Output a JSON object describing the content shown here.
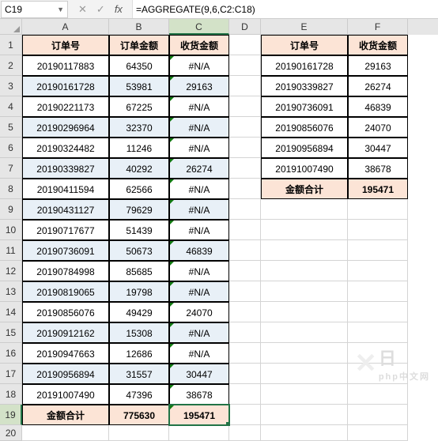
{
  "name_box": "C19",
  "formula": "=AGGREGATE(9,6,C2:C18)",
  "columns": [
    "A",
    "B",
    "C",
    "D",
    "E",
    "F"
  ],
  "left_header": {
    "a": "订单号",
    "b": "订单金额",
    "c": "收货金额"
  },
  "right_header": {
    "e": "订单号",
    "f": "收货金额"
  },
  "left_rows": [
    {
      "a": "20190117883",
      "b": "64350",
      "c": "#N/A",
      "alt": false
    },
    {
      "a": "20190161728",
      "b": "53981",
      "c": "29163",
      "alt": true
    },
    {
      "a": "20190221173",
      "b": "67225",
      "c": "#N/A",
      "alt": false
    },
    {
      "a": "20190296964",
      "b": "32370",
      "c": "#N/A",
      "alt": true
    },
    {
      "a": "20190324482",
      "b": "11246",
      "c": "#N/A",
      "alt": false
    },
    {
      "a": "20190339827",
      "b": "40292",
      "c": "26274",
      "alt": true
    },
    {
      "a": "20190411594",
      "b": "62566",
      "c": "#N/A",
      "alt": false
    },
    {
      "a": "20190431127",
      "b": "79629",
      "c": "#N/A",
      "alt": true
    },
    {
      "a": "20190717677",
      "b": "51439",
      "c": "#N/A",
      "alt": false
    },
    {
      "a": "20190736091",
      "b": "50673",
      "c": "46839",
      "alt": true
    },
    {
      "a": "20190784998",
      "b": "85685",
      "c": "#N/A",
      "alt": false
    },
    {
      "a": "20190819065",
      "b": "19798",
      "c": "#N/A",
      "alt": true
    },
    {
      "a": "20190856076",
      "b": "49429",
      "c": "24070",
      "alt": false
    },
    {
      "a": "20190912162",
      "b": "15308",
      "c": "#N/A",
      "alt": true
    },
    {
      "a": "20190947663",
      "b": "12686",
      "c": "#N/A",
      "alt": false
    },
    {
      "a": "20190956894",
      "b": "31557",
      "c": "30447",
      "alt": true
    },
    {
      "a": "20191007490",
      "b": "47396",
      "c": "38678",
      "alt": false
    }
  ],
  "left_sum": {
    "a": "金额合计",
    "b": "775630",
    "c": "195471"
  },
  "right_rows": [
    {
      "e": "20190161728",
      "f": "29163"
    },
    {
      "e": "20190339827",
      "f": "26274"
    },
    {
      "e": "20190736091",
      "f": "46839"
    },
    {
      "e": "20190856076",
      "f": "24070"
    },
    {
      "e": "20190956894",
      "f": "30447"
    },
    {
      "e": "20191007490",
      "f": "38678"
    }
  ],
  "right_sum": {
    "e": "金额合计",
    "f": "195471"
  },
  "watermark": {
    "main": "日",
    "sub": "php中文网"
  }
}
